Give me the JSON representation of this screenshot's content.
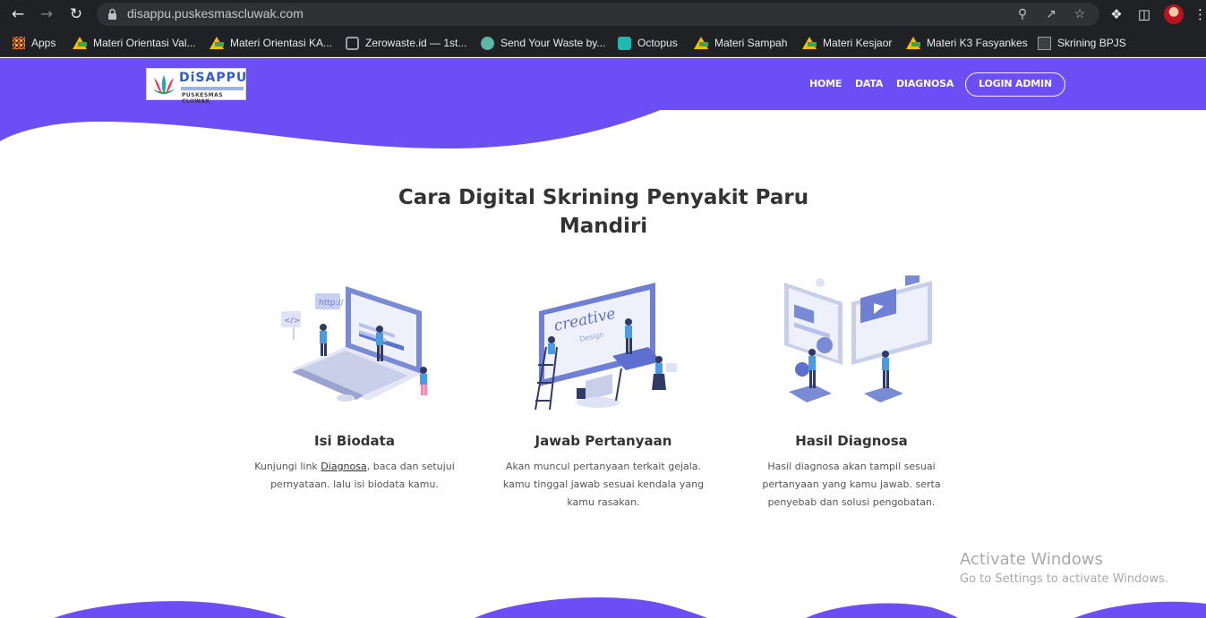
{
  "browser": {
    "url": "disappu.puskesmascluwak.com",
    "bookmarks": [
      {
        "label": "Apps",
        "icon": "apps-grid-icon"
      },
      {
        "label": "Materi Orientasi Val...",
        "icon": "google-drive-icon"
      },
      {
        "label": "Materi Orientasi KA...",
        "icon": "google-drive-icon"
      },
      {
        "label": "Zerowaste.id — 1st...",
        "icon": "zerowaste-icon"
      },
      {
        "label": "Send Your Waste by...",
        "icon": "waste-icon"
      },
      {
        "label": "Octopus",
        "icon": "octopus-icon"
      },
      {
        "label": "Materi Sampah",
        "icon": "google-drive-icon"
      },
      {
        "label": "Materi Kesjaor",
        "icon": "google-drive-icon"
      },
      {
        "label": "Materi K3 Fasyankes",
        "icon": "google-drive-icon"
      },
      {
        "label": "Skrining BPJS",
        "icon": "page-icon"
      }
    ]
  },
  "site": {
    "brand_color": "#6c4ef5",
    "logo": {
      "title": "DiSAPPU",
      "tagline": "PUSKESMAS CLUWAK"
    },
    "nav": {
      "home": "HOME",
      "data": "DATA",
      "diagnosa": "DIAGNOSA",
      "login": "LOGIN ADMIN"
    }
  },
  "main": {
    "title_line1": "Cara Digital Skrining Penyakit Paru",
    "title_line2": "Mandiri",
    "steps": [
      {
        "title": "Isi Biodata",
        "text_prefix": "Kunjungi link ",
        "link": "Diagnosa",
        "text_suffix": ", baca dan setujui",
        "line2": "pernyataan. lalu isi biodata kamu."
      },
      {
        "title": "Jawab Pertanyaan",
        "line1": "Akan muncul pertanyaan terkait gejala.",
        "line2": "kamu tinggal jawab sesuai kendala yang",
        "line3": "kamu rasakan."
      },
      {
        "title": "Hasil Diagnosa",
        "line1": "Hasil diagnosa akan tampil sesuai",
        "line2": "pertanyaan yang kamu jawab. serta",
        "line3": "penyebab dan solusi pengobatan."
      }
    ]
  },
  "watermark": {
    "title": "Activate Windows",
    "subtitle": "Go to Settings to activate Windows."
  }
}
